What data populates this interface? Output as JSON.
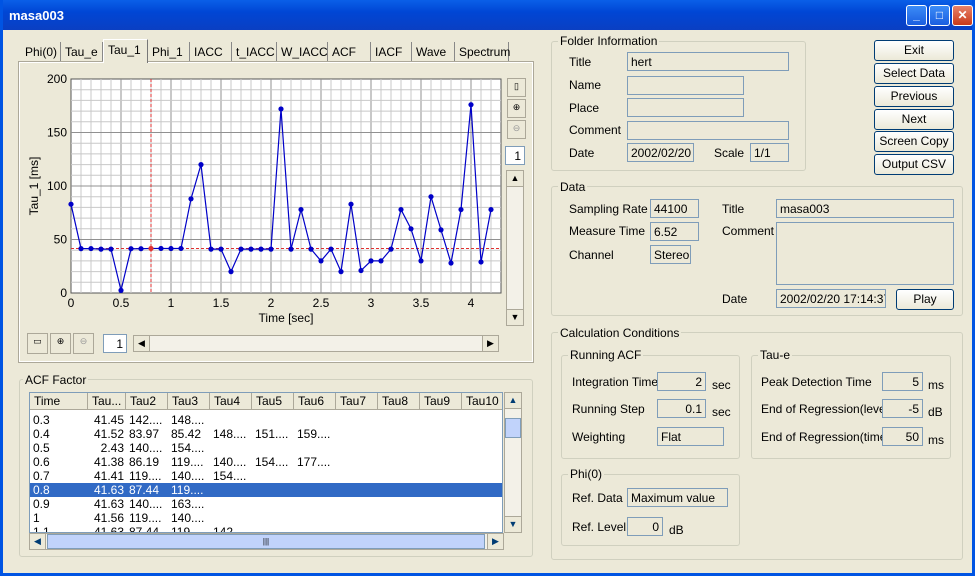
{
  "window": {
    "title": "masa003"
  },
  "tabs": [
    "Phi(0)",
    "Tau_e",
    "Tau_1",
    "Phi_1",
    "IACC",
    "t_IACC",
    "W_IACC",
    "ACF",
    "IACF",
    "Wave",
    "Spectrum"
  ],
  "active_tab": "Tau_1",
  "chart_data": {
    "type": "line",
    "ylabel": "Tau_1 [ms]",
    "xlabel": "Time [sec]",
    "xlim": [
      0,
      4.3
    ],
    "ylim": [
      0,
      200
    ],
    "xticks": [
      "0",
      "0.5",
      "1",
      "1.5",
      "2",
      "2.5",
      "3",
      "3.5",
      "4"
    ],
    "yticks": [
      "0",
      "50",
      "100",
      "150",
      "200"
    ],
    "grid": true,
    "cursor_x": 0.8,
    "cursor_y": 41.63,
    "x": [
      0,
      0.1,
      0.2,
      0.3,
      0.4,
      0.5,
      0.6,
      0.7,
      0.8,
      0.9,
      1.0,
      1.1,
      1.2,
      1.3,
      1.4,
      1.5,
      1.6,
      1.7,
      1.8,
      1.9,
      2.0,
      2.1,
      2.2,
      2.3,
      2.4,
      2.5,
      2.6,
      2.7,
      2.8,
      2.9,
      3.0,
      3.1,
      3.2,
      3.3,
      3.4,
      3.5,
      3.6,
      3.7,
      3.8,
      3.9,
      4.0,
      4.1,
      4.2
    ],
    "values": [
      83,
      41.45,
      41.52,
      41,
      41,
      2.43,
      41.38,
      41.41,
      41.63,
      41.63,
      41.56,
      41.63,
      88,
      120,
      41,
      41,
      20,
      41,
      41,
      41,
      41,
      172,
      41,
      78,
      41,
      30,
      41,
      20,
      83,
      21,
      30,
      30,
      41,
      78,
      60,
      30,
      90,
      59,
      28,
      78,
      176,
      29,
      78
    ]
  },
  "plot_controls": {
    "page_value": "1",
    "hscroll_value": "1"
  },
  "acf": {
    "label": "ACF Factor",
    "columns": [
      "Time",
      "Tau...",
      "Tau2",
      "Tau3",
      "Tau4",
      "Tau5",
      "Tau6",
      "Tau7",
      "Tau8",
      "Tau9",
      "Tau10"
    ],
    "rows": [
      [
        "0.3",
        "41.45",
        "142....",
        "148....",
        "",
        "",
        "",
        "",
        "",
        "",
        ""
      ],
      [
        "0.4",
        "41.52",
        "83.97",
        "85.42",
        "148....",
        "151....",
        "159....",
        "",
        "",
        "",
        ""
      ],
      [
        "0.5",
        "2.43",
        "140....",
        "154....",
        "",
        "",
        "",
        "",
        "",
        "",
        ""
      ],
      [
        "0.6",
        "41.38",
        "86.19",
        "119....",
        "140....",
        "154....",
        "177....",
        "",
        "",
        "",
        ""
      ],
      [
        "0.7",
        "41.41",
        "119....",
        "140....",
        "154....",
        "",
        "",
        "",
        "",
        "",
        ""
      ],
      [
        "0.8",
        "41.63",
        "87.44",
        "119....",
        "",
        "",
        "",
        "",
        "",
        "",
        ""
      ],
      [
        "0.9",
        "41.63",
        "140....",
        "163....",
        "",
        "",
        "",
        "",
        "",
        "",
        ""
      ],
      [
        "1",
        "41.56",
        "119....",
        "140....",
        "",
        "",
        "",
        "",
        "",
        "",
        ""
      ],
      [
        "1.1",
        "41.63",
        "87.44",
        "119....",
        "142....",
        "",
        "",
        "",
        "",
        "",
        ""
      ]
    ],
    "selected_row": 5
  },
  "folder": {
    "label": "Folder Information",
    "title_label": "Title",
    "title": "hert",
    "name_label": "Name",
    "place_label": "Place",
    "comment_label": "Comment",
    "date_label": "Date",
    "date": "2002/02/20",
    "scale_label": "Scale",
    "scale": "1/1"
  },
  "buttons": {
    "exit": "Exit",
    "select": "Select Data",
    "previous": "Previous",
    "next": "Next",
    "screen_copy": "Screen Copy",
    "output_csv": "Output CSV"
  },
  "data": {
    "label": "Data",
    "sampling_label": "Sampling Rate",
    "sampling": "44100",
    "measure_label": "Measure Time",
    "measure": "6.52",
    "channel_label": "Channel",
    "channel": "Stereo",
    "title_label": "Title",
    "title": "masa003",
    "comment_label": "Comment",
    "date_label": "Date",
    "date": "2002/02/20 17:14:37",
    "play": "Play"
  },
  "calc": {
    "label": "Calculation Conditions",
    "running_acf": "Running ACF",
    "integ_label": "Integration Time",
    "integ": "2",
    "integ_unit": "sec",
    "step_label": "Running Step",
    "step": "0.1",
    "step_unit": "sec",
    "weight_label": "Weighting",
    "weight": "Flat",
    "taue": "Tau-e",
    "peak_label": "Peak Detection Time",
    "peak": "5",
    "peak_unit": "ms",
    "eorl_label": "End of Regression(level)",
    "eorl": "-5",
    "eorl_unit": "dB",
    "eort_label": "End of Regression(time)",
    "eort": "50",
    "eort_unit": "ms",
    "phi0": "Phi(0)",
    "ref_data_label": "Ref. Data",
    "ref_data": "Maximum value",
    "ref_level_label": "Ref. Level",
    "ref_level": "0",
    "ref_level_unit": "dB"
  },
  "colors": {
    "line": "#0000c8",
    "cursor": "#e03030",
    "selection": "#316ac5"
  }
}
